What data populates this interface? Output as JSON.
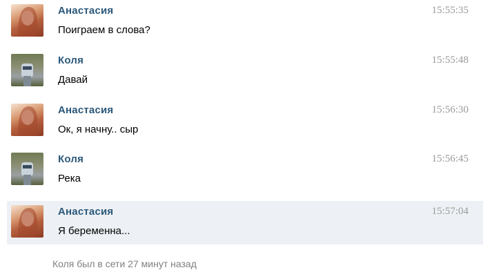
{
  "messages": [
    {
      "author": "Анастасия",
      "text": "Поиграем в слова?",
      "time": "15:55:35",
      "avatar": "female-avatar"
    },
    {
      "author": "Коля",
      "text": "Давай",
      "time": "15:55:48",
      "avatar": "male-avatar"
    },
    {
      "author": "Анастасия",
      "text": "Ок, я начну.. сыр",
      "time": "15:56:30",
      "avatar": "female-avatar"
    },
    {
      "author": "Коля",
      "text": "Река",
      "time": "15:56:45",
      "avatar": "male-avatar"
    },
    {
      "author": "Анастасия",
      "text": "Я беременна...",
      "time": "15:57:04",
      "avatar": "female-avatar"
    }
  ],
  "status": {
    "text": "Коля был в сети 27 минут назад"
  },
  "colors": {
    "name": "#2b587a",
    "time": "#999999",
    "highlight_bg": "#edf1f5",
    "status": "#808080"
  }
}
